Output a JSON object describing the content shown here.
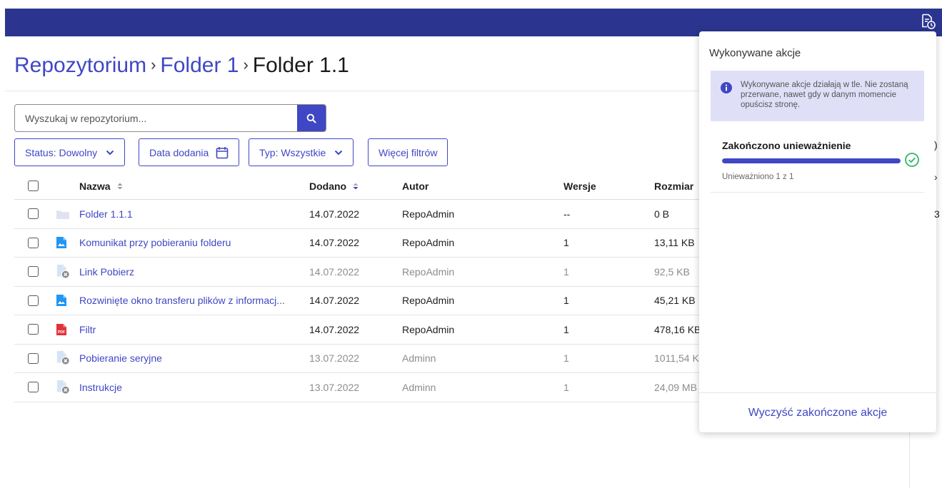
{
  "header": {
    "actions_icon": "file-clock-icon",
    "color": "#2b3590"
  },
  "breadcrumb": {
    "items": [
      "Repozytorium",
      "Folder 1"
    ],
    "separator": "›",
    "current": "Folder 1.1"
  },
  "search": {
    "placeholder": "Wyszukaj w repozytorium...",
    "value": "",
    "button_icon": "search-icon"
  },
  "filters": {
    "status": "Status: Dowolny",
    "date": "Data dodania",
    "type": "Typ: Wszystkie",
    "more": "Więcej filtrów"
  },
  "table": {
    "columns": {
      "name": "Nazwa",
      "added": "Dodano",
      "author": "Autor",
      "versions": "Wersje",
      "size": "Rozmiar"
    },
    "rows": [
      {
        "icon": "folder-icon",
        "name": "Folder 1.1.1",
        "added": "14.07.2022",
        "author": "RepoAdmin",
        "versions": "--",
        "size": "0 B",
        "muted": false
      },
      {
        "icon": "image-file-icon",
        "name": "Komunikat przy pobieraniu folderu",
        "added": "14.07.2022",
        "author": "RepoAdmin",
        "versions": "1",
        "size": "13,11 KB",
        "muted": false
      },
      {
        "icon": "invalidated-file-icon",
        "name": "Link Pobierz",
        "added": "14.07.2022",
        "author": "RepoAdmin",
        "versions": "1",
        "size": "92,5 KB",
        "muted": true
      },
      {
        "icon": "image-file-icon",
        "name": "Rozwinięte okno transferu plików z informacj...",
        "added": "14.07.2022",
        "author": "RepoAdmin",
        "versions": "1",
        "size": "45,21 KB",
        "muted": false
      },
      {
        "icon": "pdf-file-icon",
        "name": "Filtr",
        "added": "14.07.2022",
        "author": "RepoAdmin",
        "versions": "1",
        "size": "478,16 KB",
        "muted": false
      },
      {
        "icon": "invalidated-file-icon",
        "name": "Pobieranie seryjne",
        "added": "13.07.2022",
        "author": "Adminn",
        "versions": "1",
        "size": "1011,54 K",
        "muted": true
      },
      {
        "icon": "invalidated-file-icon",
        "name": "Instrukcje",
        "added": "13.07.2022",
        "author": "Adminn",
        "versions": "1",
        "size": "24,09 MB",
        "muted": true
      }
    ]
  },
  "actions_panel": {
    "title": "Wykonywane akcje",
    "info": "Wykonywane akcje działają w tle. Nie zostaną przerwane, nawet gdy w danym momencie opuścisz stronę.",
    "task": {
      "title": "Zakończono unieważnienie",
      "progress": 1.0,
      "subtitle": "Unieważniono 1 z 1",
      "status_icon": "check-circle-icon"
    },
    "clear_button": "Wyczyść zakończone akcje"
  },
  "colors": {
    "accent": "#3f47c4",
    "success": "#2db567",
    "pdf": "#e0323b",
    "info_bg": "#dfe0f8"
  }
}
